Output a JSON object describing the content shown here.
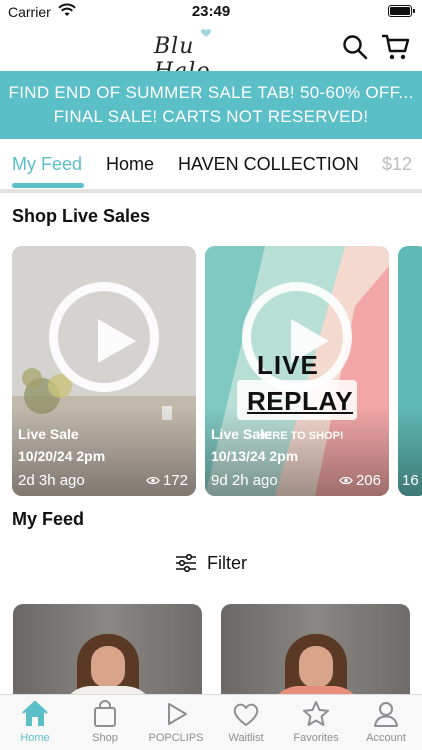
{
  "status_bar": {
    "carrier": "Carrier",
    "time": "23:49"
  },
  "header": {
    "logo_text": "Blu Halo"
  },
  "banner": {
    "line1": "FIND END OF SUMMER SALE TAB! 50-60% OFF...",
    "line2": "FINAL SALE! CARTS NOT RESERVED!",
    "color": "#5bbfc8"
  },
  "tabs": [
    {
      "label": "My Feed",
      "active": true
    },
    {
      "label": "Home"
    },
    {
      "label": "HAVEN COLLECTION"
    },
    {
      "label": "$12"
    }
  ],
  "live_sales": {
    "title": "Shop Live Sales",
    "cards": [
      {
        "label": "Live Sale",
        "date": "10/20/24 2pm",
        "ago": "2d 3h ago",
        "views": "172"
      },
      {
        "label": "Live Sale",
        "date": "10/13/24 2pm",
        "ago": "9d 2h ago",
        "views": "206",
        "overlay_live": "LIVE",
        "overlay_replay": "REPLAY",
        "overlay_shop": "HERE TO SHOP!"
      },
      {
        "ago": "16"
      }
    ]
  },
  "feed": {
    "title": "My Feed",
    "filter_label": "Filter"
  },
  "bottom_nav": [
    {
      "label": "Home",
      "icon": "home-icon",
      "active": true
    },
    {
      "label": "Shop",
      "icon": "bag-icon"
    },
    {
      "label": "POPCLIPS",
      "icon": "play-icon"
    },
    {
      "label": "Waitlist",
      "icon": "heart-icon"
    },
    {
      "label": "Favorites",
      "icon": "star-icon"
    },
    {
      "label": "Account",
      "icon": "person-icon"
    }
  ],
  "colors": {
    "accent": "#5bbfc8",
    "inactive": "#8e8e93"
  }
}
